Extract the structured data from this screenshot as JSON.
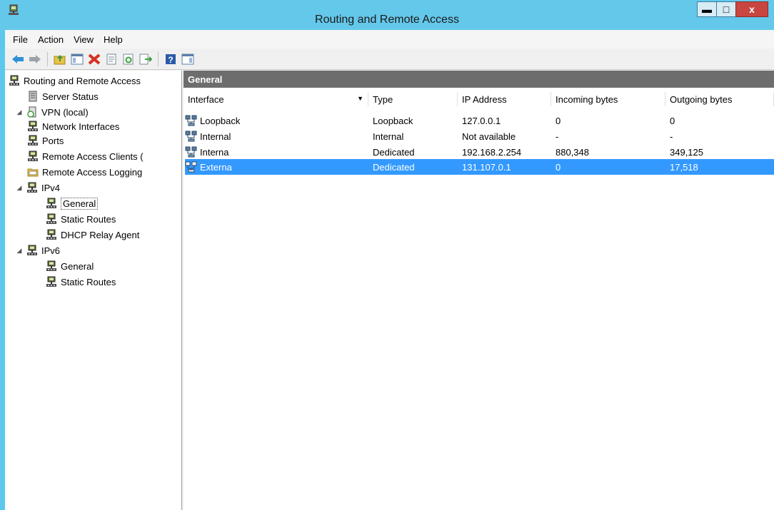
{
  "window": {
    "title": "Routing and Remote Access",
    "min_glyph": "▬",
    "max_glyph": "□",
    "close_glyph": "x"
  },
  "menu": [
    "File",
    "Action",
    "View",
    "Help"
  ],
  "toolbar": {
    "icons": [
      "back-arrow-icon",
      "forward-arrow-icon",
      "up-folder-icon",
      "show-hide-tree-icon",
      "delete-icon",
      "properties-icon",
      "refresh-icon",
      "export-list-icon",
      "help-icon",
      "show-hide-action-pane-icon"
    ]
  },
  "tree": {
    "items": [
      {
        "label": "Routing and Remote Access",
        "level": 0,
        "icon": "server-icon",
        "expander": ""
      },
      {
        "label": "Server Status",
        "level": 1,
        "icon": "status-icon",
        "expander": ""
      },
      {
        "label": "VPN (local)",
        "level": 1,
        "icon": "server-local-icon",
        "expander": "◢"
      },
      {
        "label": "Network Interfaces",
        "level": 2,
        "icon": "network-icon",
        "expander": ""
      },
      {
        "label": "Ports",
        "level": 2,
        "icon": "network-icon",
        "expander": ""
      },
      {
        "label": "Remote Access Clients (",
        "level": 2,
        "icon": "network-icon",
        "expander": ""
      },
      {
        "label": "Remote Access Logging",
        "level": 2,
        "icon": "folder-icon",
        "expander": ""
      },
      {
        "label": "IPv4",
        "level": 2,
        "icon": "network-icon",
        "expander": "◢"
      },
      {
        "label": "General",
        "level": 3,
        "icon": "network-icon",
        "expander": "",
        "selected": true
      },
      {
        "label": "Static Routes",
        "level": 3,
        "icon": "network-icon",
        "expander": ""
      },
      {
        "label": "DHCP Relay Agent",
        "level": 3,
        "icon": "network-icon",
        "expander": ""
      },
      {
        "label": "IPv6",
        "level": 2,
        "icon": "network-icon",
        "expander": "◢"
      },
      {
        "label": "General",
        "level": 3,
        "icon": "network-icon",
        "expander": ""
      },
      {
        "label": "Static Routes",
        "level": 3,
        "icon": "network-icon",
        "expander": ""
      }
    ]
  },
  "main": {
    "header": "General",
    "columns": [
      "Interface",
      "Type",
      "IP Address",
      "Incoming bytes",
      "Outgoing bytes"
    ],
    "sort_glyph": "▼",
    "rows": [
      {
        "interface": "Loopback",
        "type": "Loopback",
        "ip": "127.0.0.1",
        "in": "0",
        "out": "0",
        "selected": false
      },
      {
        "interface": "Internal",
        "type": "Internal",
        "ip": "Not available",
        "in": "-",
        "out": "-",
        "selected": false
      },
      {
        "interface": "Interna",
        "type": "Dedicated",
        "ip": "192.168.2.254",
        "in": "880,348",
        "out": "349,125",
        "selected": false
      },
      {
        "interface": "Externa",
        "type": "Dedicated",
        "ip": "131.107.0.1",
        "in": "0",
        "out": "17,518",
        "selected": true
      }
    ]
  },
  "colors": {
    "titlebar": "#64c8ea",
    "selection": "#3399ff",
    "pane_header": "#6d6d6d"
  }
}
